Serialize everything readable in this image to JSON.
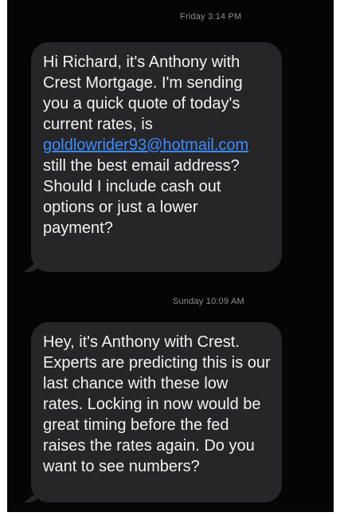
{
  "conversation": {
    "messages": [
      {
        "timestamp": "Friday 3:14 PM",
        "text_before_link": "Hi Richard, it's Anthony with Crest Mortgage. I'm sending you a quick quote of today's current rates, is ",
        "link": "goldlowrider93@hotmail.com",
        "text_after_link": " still the best email address? Should I include cash out options or just a lower payment?"
      },
      {
        "timestamp": "Sunday 10:09 AM",
        "text": "Hey, it's Anthony with Crest. Experts are predicting this is our last chance with these low rates. Locking in now would be great timing before the fed raises the rates again. Do you want to see numbers?"
      }
    ]
  },
  "colors": {
    "background": "#050505",
    "bubble": "#262628",
    "text": "#f2f2f2",
    "timestamp": "#8e8e93",
    "link": "#3d8bff"
  }
}
